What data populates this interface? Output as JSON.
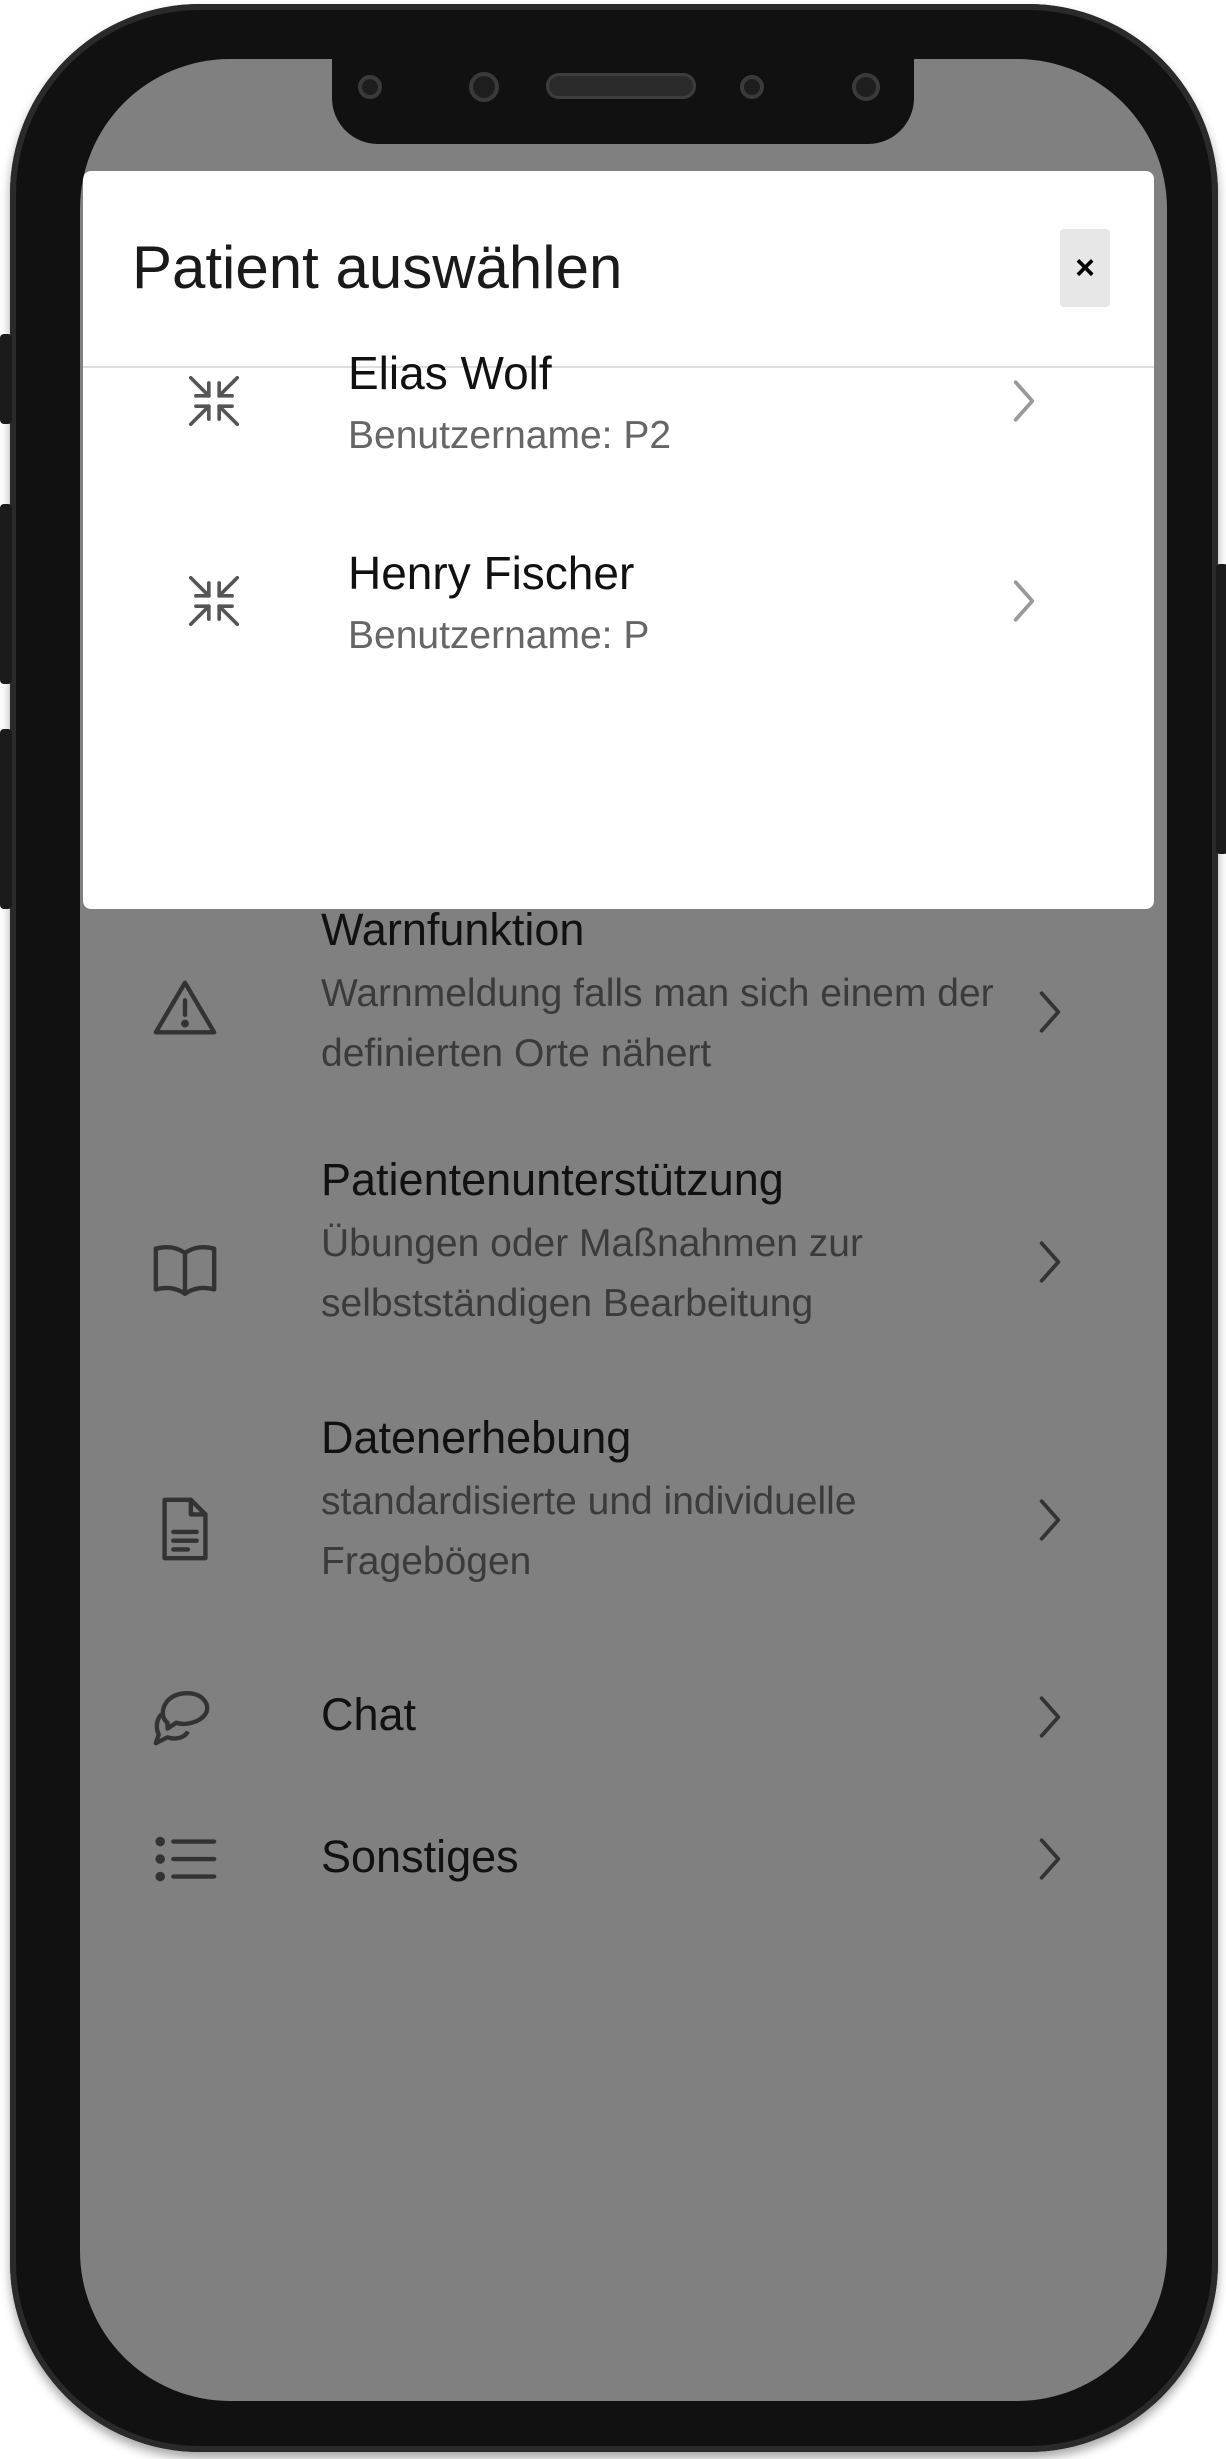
{
  "modal": {
    "title": "Patient auswählen",
    "close_label": "×",
    "patients": [
      {
        "name": "Elias Wolf",
        "username": "Benutzername: P2",
        "icon": "compress-arrows-icon"
      },
      {
        "name": "Henry Fischer",
        "username": "Benutzername: P",
        "icon": "compress-arrows-icon"
      }
    ]
  },
  "menu": {
    "items": [
      {
        "title": "Warnfunktion",
        "description": "Warnmeldung falls man sich einem der definierten Orte nähert",
        "icon": "warning-icon"
      },
      {
        "title": "Patientenunterstützung",
        "description": "Übungen oder Maßnahmen zur selbstständigen Bearbeitung",
        "icon": "book-icon"
      },
      {
        "title": "Datenerhebung",
        "description": "standardisierte und individuelle Fragebögen",
        "icon": "document-icon"
      },
      {
        "title": "Chat",
        "description": "",
        "icon": "chat-icon"
      },
      {
        "title": "Sonstiges",
        "description": "",
        "icon": "list-icon"
      }
    ]
  },
  "colors": {
    "overlay": "#808080",
    "modal_bg": "#ffffff",
    "close_bg": "#e7e7e7"
  }
}
